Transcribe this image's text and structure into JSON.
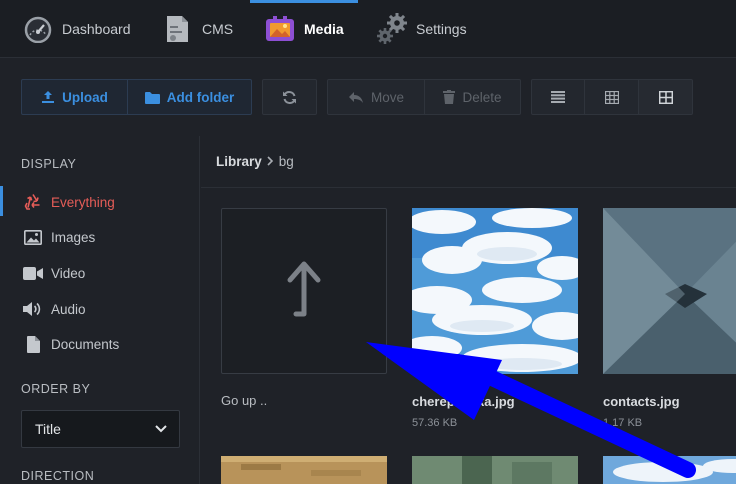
{
  "nav": {
    "items": [
      {
        "label": "Dashboard",
        "icon": "gauge-icon"
      },
      {
        "label": "CMS",
        "icon": "cms-icon"
      },
      {
        "label": "Media",
        "icon": "media-icon",
        "active": true
      },
      {
        "label": "Settings",
        "icon": "gears-icon"
      }
    ]
  },
  "toolbar": {
    "upload": "Upload",
    "add_folder": "Add folder",
    "move": "Move",
    "delete": "Delete"
  },
  "sidebar": {
    "display_title": "DISPLAY",
    "display_items": [
      {
        "label": "Everything",
        "icon": "recycle-icon",
        "active": true
      },
      {
        "label": "Images",
        "icon": "image-icon"
      },
      {
        "label": "Video",
        "icon": "video-icon"
      },
      {
        "label": "Audio",
        "icon": "audio-icon"
      },
      {
        "label": "Documents",
        "icon": "document-icon"
      }
    ],
    "order_title": "ORDER BY",
    "order_value": "Title",
    "direction_title": "DIRECTION"
  },
  "breadcrumb": {
    "root": "Library",
    "current": "bg"
  },
  "files": [
    {
      "name": "Go up ..",
      "size": ""
    },
    {
      "name": "cherepashka.jpg",
      "size": "57.36 KB"
    },
    {
      "name": "contacts.jpg",
      "size": "1.17 KB"
    }
  ],
  "colors": {
    "accent": "#3b8fe0",
    "active_filter": "#e65d58",
    "annotation_arrow": "#0000ff"
  }
}
